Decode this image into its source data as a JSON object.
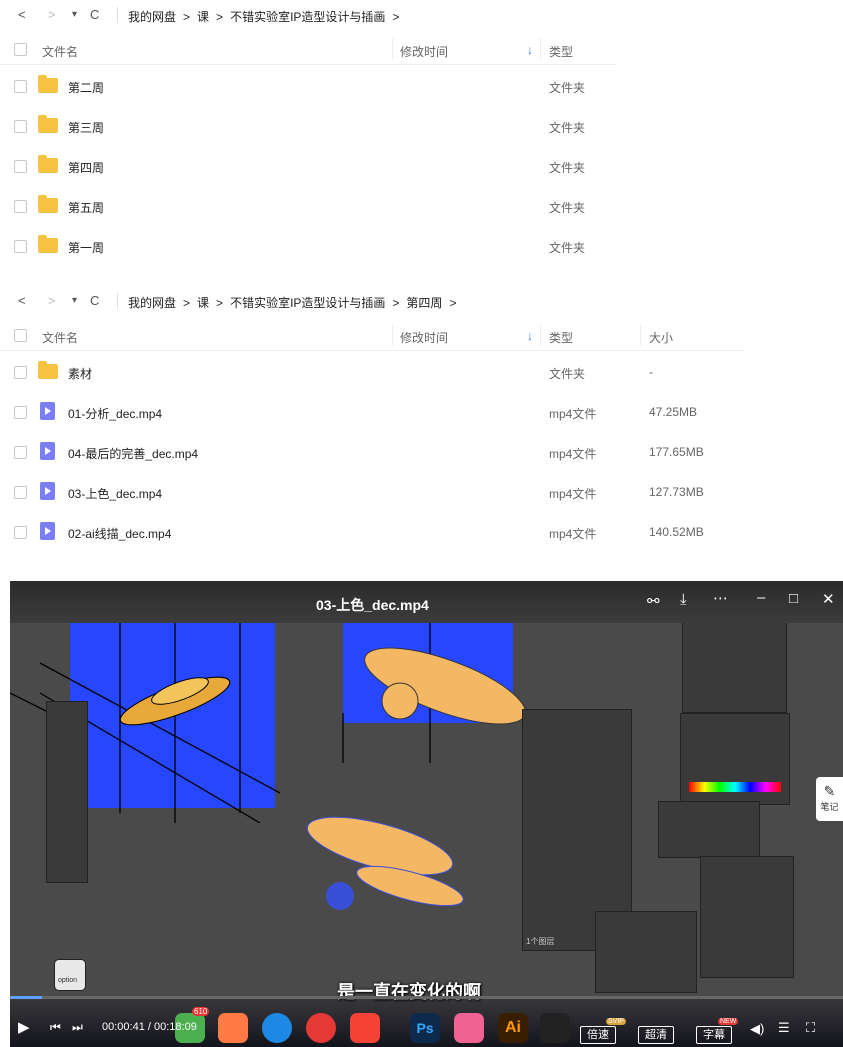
{
  "panel1": {
    "breadcrumb": [
      "我的网盘",
      ">",
      "课",
      ">",
      "不错实验室IP造型设计与插画",
      ">"
    ],
    "columns": {
      "name": "文件名",
      "modified": "修改时间",
      "sort": "↓",
      "type": "类型"
    },
    "rows": [
      {
        "name": "第二周",
        "type": "文件夹"
      },
      {
        "name": "第三周",
        "type": "文件夹"
      },
      {
        "name": "第四周",
        "type": "文件夹"
      },
      {
        "name": "第五周",
        "type": "文件夹"
      },
      {
        "name": "第一周",
        "type": "文件夹"
      }
    ]
  },
  "panel2": {
    "breadcrumb": [
      "我的网盘",
      ">",
      "课",
      ">",
      "不错实验室IP造型设计与插画",
      ">",
      "第四周",
      ">"
    ],
    "columns": {
      "name": "文件名",
      "modified": "修改时间",
      "sort": "↓",
      "type": "类型",
      "size": "大小"
    },
    "rows": [
      {
        "name": "素材",
        "type": "文件夹",
        "size": "-",
        "icon": "folder"
      },
      {
        "name": "01-分析_dec.mp4",
        "type": "mp4文件",
        "size": "47.25MB",
        "icon": "video"
      },
      {
        "name": "04-最后的完善_dec.mp4",
        "type": "mp4文件",
        "size": "177.65MB",
        "icon": "video"
      },
      {
        "name": "03-上色_dec.mp4",
        "type": "mp4文件",
        "size": "127.73MB",
        "icon": "video"
      },
      {
        "name": "02-ai线描_dec.mp4",
        "type": "mp4文件",
        "size": "140.52MB",
        "icon": "video"
      }
    ]
  },
  "nav": {
    "back": "<",
    "forward": ">",
    "dropdown": "▾",
    "refresh": "C"
  },
  "video": {
    "title": "03-上色_dec.mp4",
    "subtitle": "是一直在变化的啊",
    "time": "00:00:41 / 00:18:09",
    "progress": 0.038,
    "speed_label": "倍速",
    "speed_badge": "SVIP",
    "quality_label": "超清",
    "subtitle_label": "字幕",
    "subtitle_badge": "NEW",
    "side_label": "笔记",
    "option_label": "option",
    "dock_badge": "610",
    "dock_ps": "Ps",
    "dock_ai": "Ai",
    "panel_text": "1个图层",
    "accent": "#2747ff"
  }
}
